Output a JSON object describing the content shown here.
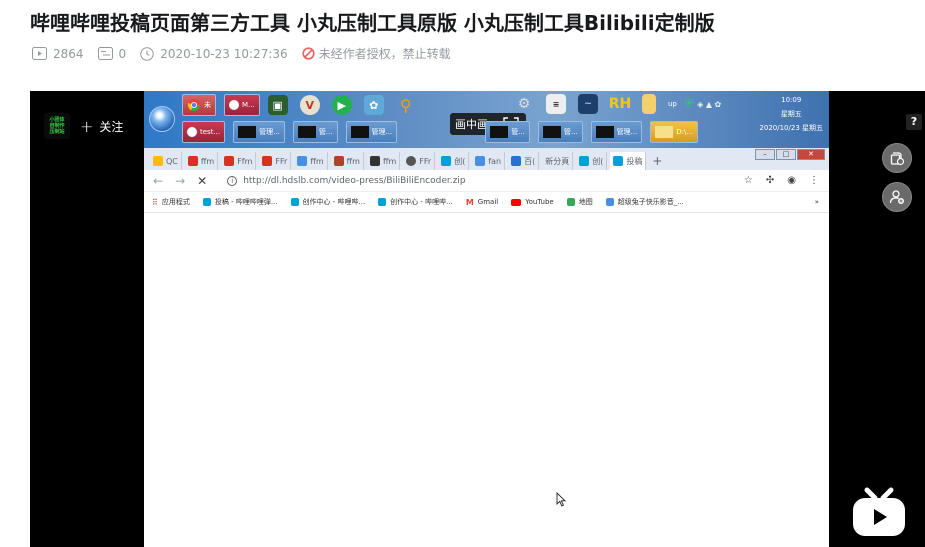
{
  "title": "哔哩哔哩投稿页面第三方工具 小丸压制工具原版 小丸压制工具Bilibili定制版",
  "meta": {
    "views": "2864",
    "danmaku": "0",
    "datetime": "2020-10-23 10:27:36",
    "copyright_notice": "未经作者授权，禁止转载"
  },
  "player": {
    "uploader_avatar_lines": [
      "小团体",
      "自制作",
      "压制站"
    ],
    "follow_label": "关注",
    "help_label": "?",
    "pip_label": "画中画"
  },
  "taskbar": {
    "row1": [
      {
        "label": "未",
        "color": "#d9534f"
      },
      {
        "label": "M...",
        "color": "#b52d4a"
      }
    ],
    "row1_icons": [
      "terminal-icon",
      "opera-icon",
      "play-icon",
      "settings-icon",
      "search-icon",
      "pip",
      "gear-icon",
      "document-icon",
      "monitor-icon"
    ],
    "rh": "RH",
    "up": "up",
    "clock_time": "10:09",
    "clock_weekday": "星期五",
    "clock_date": "2020/10/23 星期五",
    "row2": [
      "test...",
      "管理...",
      "管...",
      "管理...",
      "管...",
      "管...",
      "管理...",
      "D:\\..."
    ]
  },
  "chrome": {
    "tabs": [
      "QC",
      "ffm",
      "Ffm",
      "FFr",
      "ffm",
      "ffm",
      "ffm",
      "FFr",
      "创(",
      "fan",
      "百(",
      "新分頁",
      "创(",
      "投稿"
    ],
    "new_tab": "+",
    "url": "http://dl.hdslb.com/video-press/BiliBiliEncoder.zip",
    "bookmarks": [
      {
        "label": "应用程式",
        "color": "#5f6368"
      },
      {
        "label": "投稿 - 哔哩哔哩弹...",
        "color": "#00a1d6"
      },
      {
        "label": "创作中心 - 哔哩哔...",
        "color": "#00a1d6"
      },
      {
        "label": "创作中心 - 哔哩哔...",
        "color": "#00a1d6"
      },
      {
        "label": "Gmail",
        "color": "#ea4335"
      },
      {
        "label": "YouTube",
        "color": "#ff0000"
      },
      {
        "label": "地图",
        "color": "#34a853"
      },
      {
        "label": "超级兔子快乐影音_...",
        "color": "#4a90e2"
      }
    ],
    "bookmarks_more": "»"
  }
}
